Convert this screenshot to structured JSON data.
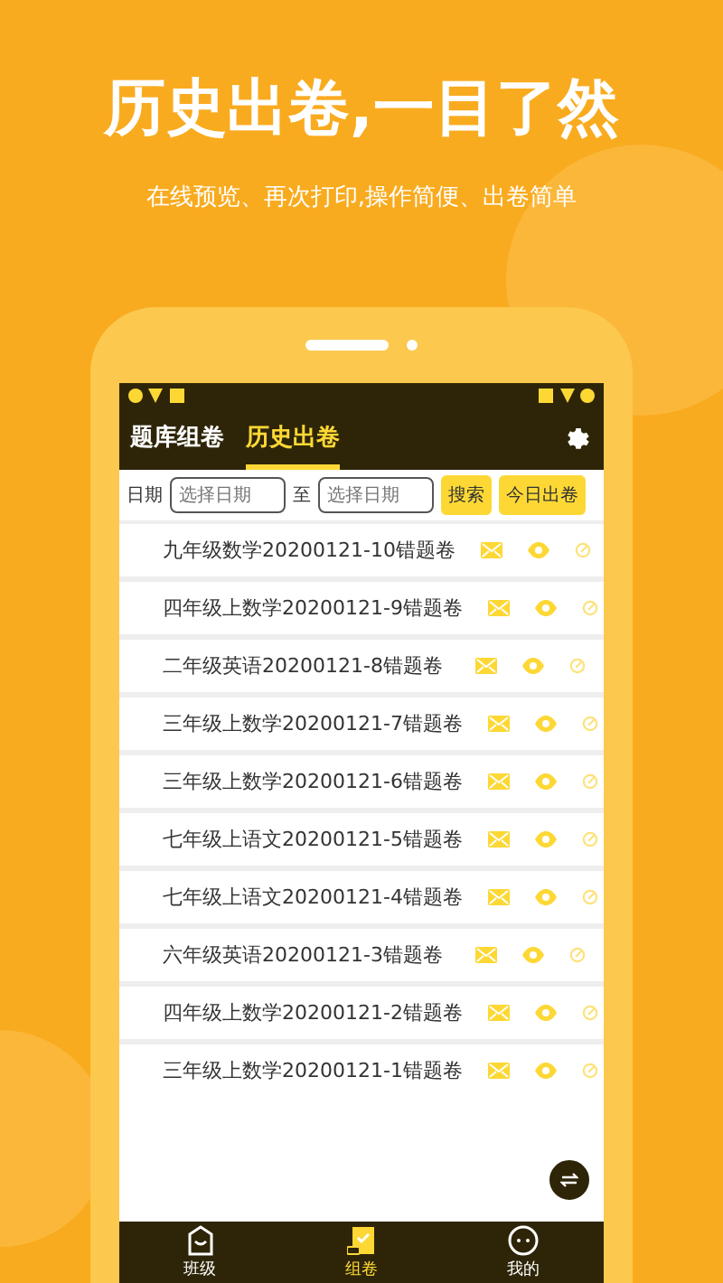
{
  "headline": "历史出卷,一目了然",
  "subtitle": "在线预览、再次打印,操作简便、出卷简单",
  "tabs": [
    {
      "label": "题库组卷",
      "selected": false
    },
    {
      "label": "历史出卷",
      "selected": true
    }
  ],
  "filter": {
    "label": "日期",
    "from_placeholder": "选择日期",
    "separator": "至",
    "to_placeholder": "选择日期",
    "search_button": "搜索",
    "today_button": "今日出卷"
  },
  "papers": [
    {
      "title": "九年级数学20200121-10错题卷"
    },
    {
      "title": "四年级上数学20200121-9错题卷"
    },
    {
      "title": "二年级英语20200121-8错题卷"
    },
    {
      "title": "三年级上数学20200121-7错题卷"
    },
    {
      "title": "三年级上数学20200121-6错题卷"
    },
    {
      "title": "七年级上语文20200121-5错题卷"
    },
    {
      "title": "七年级上语文20200121-4错题卷"
    },
    {
      "title": "六年级英语20200121-3错题卷"
    },
    {
      "title": "四年级上数学20200121-2错题卷"
    },
    {
      "title": "三年级上数学20200121-1错题卷"
    }
  ],
  "bottom_nav": [
    {
      "label": "班级",
      "kind": "class",
      "selected": false
    },
    {
      "label": "组卷",
      "kind": "compose",
      "selected": true
    },
    {
      "label": "我的",
      "kind": "me",
      "selected": false
    }
  ]
}
